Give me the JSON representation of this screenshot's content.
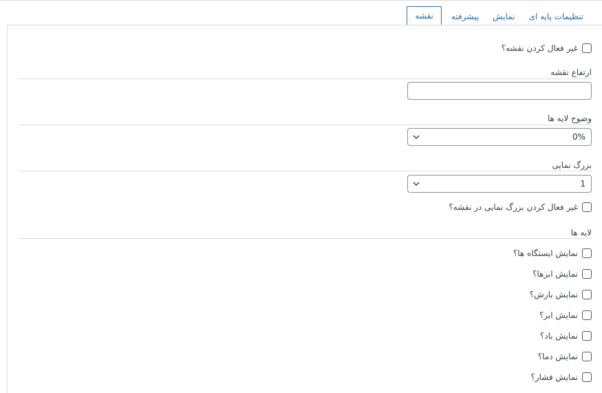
{
  "tabs": {
    "basic_settings": "تنظیمات پایه ای",
    "display": "نمایش",
    "advanced": "پیشرفته",
    "map": "نقشه"
  },
  "map_settings": {
    "disable_map_label": "غیر فعال کردن نقشه؟",
    "map_height_label": "ارتفاع نقشه",
    "map_height_value": "",
    "layer_opacity_label": "وضوح لایه ها",
    "layer_opacity_value": "0%",
    "zoom_label": "بزرگ نمایی",
    "zoom_value": "1",
    "disable_zoom_label": "غیر فعال کردن بزرگ نمایی در نقشه؟",
    "layers_label": "لایه ها",
    "layers": [
      "نمایش ایستگاه ها؟",
      "نمایش ابرها؟",
      "نمایش بارش؟",
      "نمایش ابر؟",
      "نمایش باد؟",
      "نمایش دما؟",
      "نمایش فشار؟"
    ]
  },
  "colors": {
    "accent": "#2271b1",
    "border": "#dcdcde",
    "text": "#3c434a"
  }
}
